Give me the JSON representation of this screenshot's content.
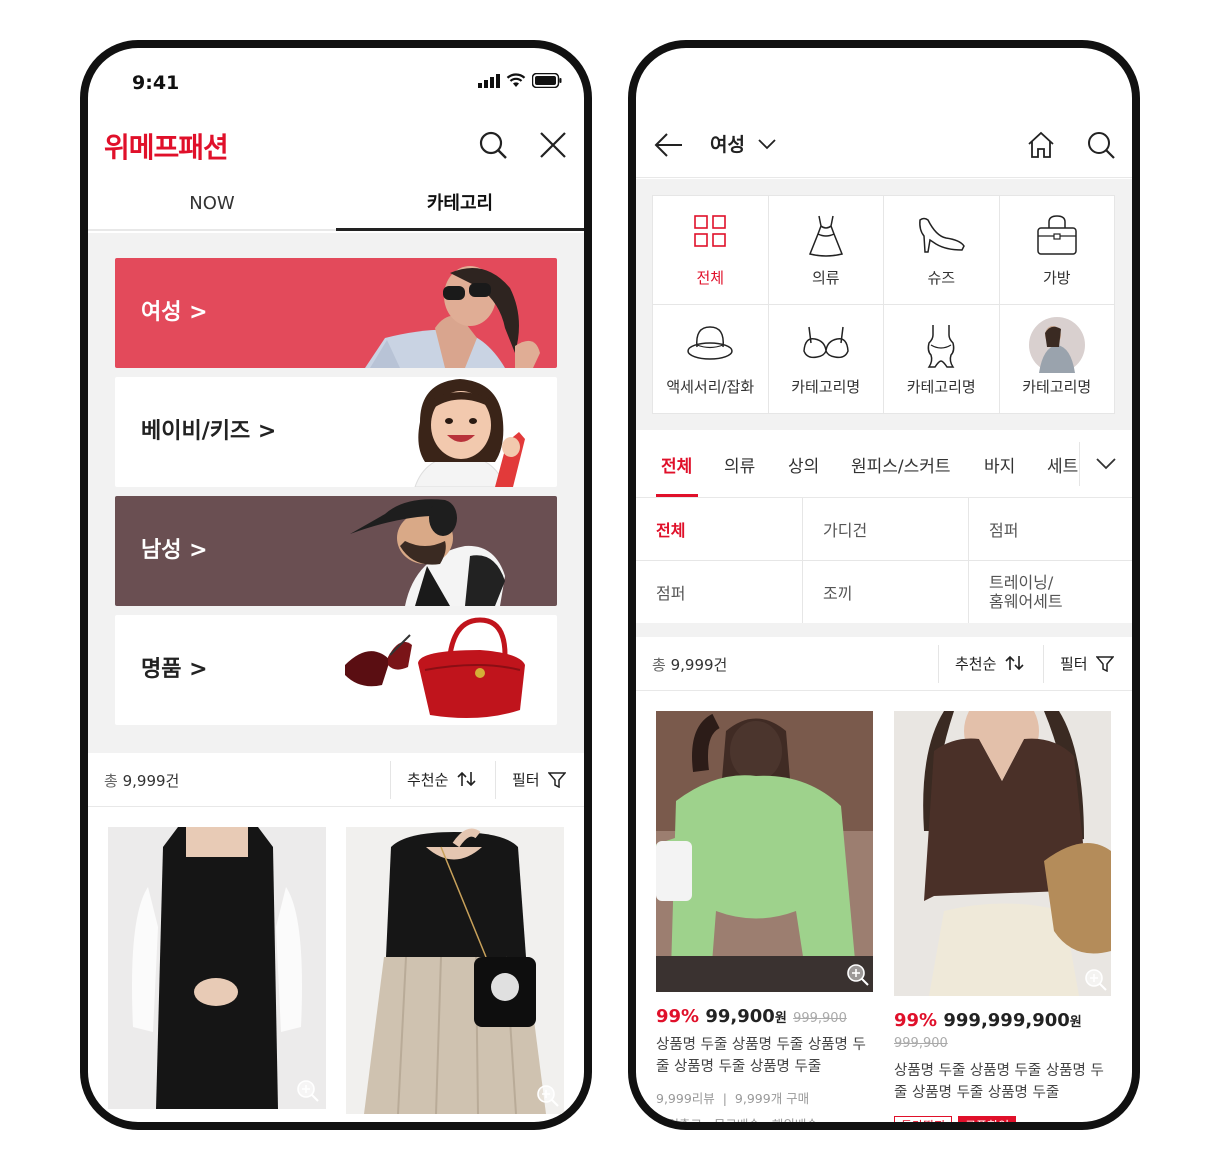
{
  "left": {
    "status": {
      "time": "9:41"
    },
    "header": {
      "logo": "위메프패션"
    },
    "tabs": [
      {
        "label": "NOW"
      },
      {
        "label": "카테고리"
      }
    ],
    "banners": [
      {
        "label": "여성 >",
        "bg": "#e34a5b",
        "text_color": "#ffffff"
      },
      {
        "label": "베이비/키즈 >",
        "bg": "#ffffff",
        "text_color": "#222222"
      },
      {
        "label": "남성 >",
        "bg": "#6a4f52",
        "text_color": "#ffffff"
      },
      {
        "label": "명품 >",
        "bg": "#ffffff",
        "text_color": "#222222"
      }
    ],
    "sort": {
      "count_prefix": "총",
      "count": "9,999건",
      "sort_label": "추천순",
      "filter_label": "필터"
    },
    "products": {
      "partial_price": "99% 99,900원"
    }
  },
  "right": {
    "header": {
      "title": "여성"
    },
    "categories": [
      {
        "label": "전체",
        "icon": "grid-icon",
        "active": true
      },
      {
        "label": "의류",
        "icon": "dress-icon"
      },
      {
        "label": "슈즈",
        "icon": "heel-shoe-icon"
      },
      {
        "label": "가방",
        "icon": "handbag-icon"
      },
      {
        "label": "액세서리/잡화",
        "icon": "hat-icon"
      },
      {
        "label": "카테고리명",
        "icon": "bra-icon"
      },
      {
        "label": "카테고리명",
        "icon": "swimsuit-icon"
      },
      {
        "label": "카테고리명",
        "icon": "photo-thumbnail"
      }
    ],
    "subtabs": [
      "전체",
      "의류",
      "상의",
      "원피스/스커트",
      "바지",
      "세트"
    ],
    "subcategories": [
      "전체",
      "가디건",
      "점퍼",
      "점퍼",
      "조끼",
      "트레이닝/\n홈웨어세트"
    ],
    "sort": {
      "count_prefix": "총",
      "count": "9,999건",
      "sort_label": "추천순",
      "filter_label": "필터"
    },
    "products": [
      {
        "discount": "99%",
        "price": "99,900",
        "currency": "원",
        "original_price": "999,900",
        "name": "상품명 두줄 상품명 두줄 상품명 두줄 상품명 두줄 상품명 두줄",
        "reviews": "9,999리뷰",
        "purchases": "9,999개 구매",
        "shipping": "당일출고 · 무료배송 · 해외배송"
      },
      {
        "discount": "99%",
        "price": "999,999,900",
        "currency": "원",
        "original_price": "999,900",
        "name": "상품명 두줄 상품명 두줄 상품명 두줄 상품명 두줄 상품명 두줄",
        "badges": [
          "특가딱지",
          "쿠폰할인"
        ]
      }
    ]
  },
  "colors": {
    "accent": "#e0102a",
    "bg_gray": "#f2f2f2"
  }
}
